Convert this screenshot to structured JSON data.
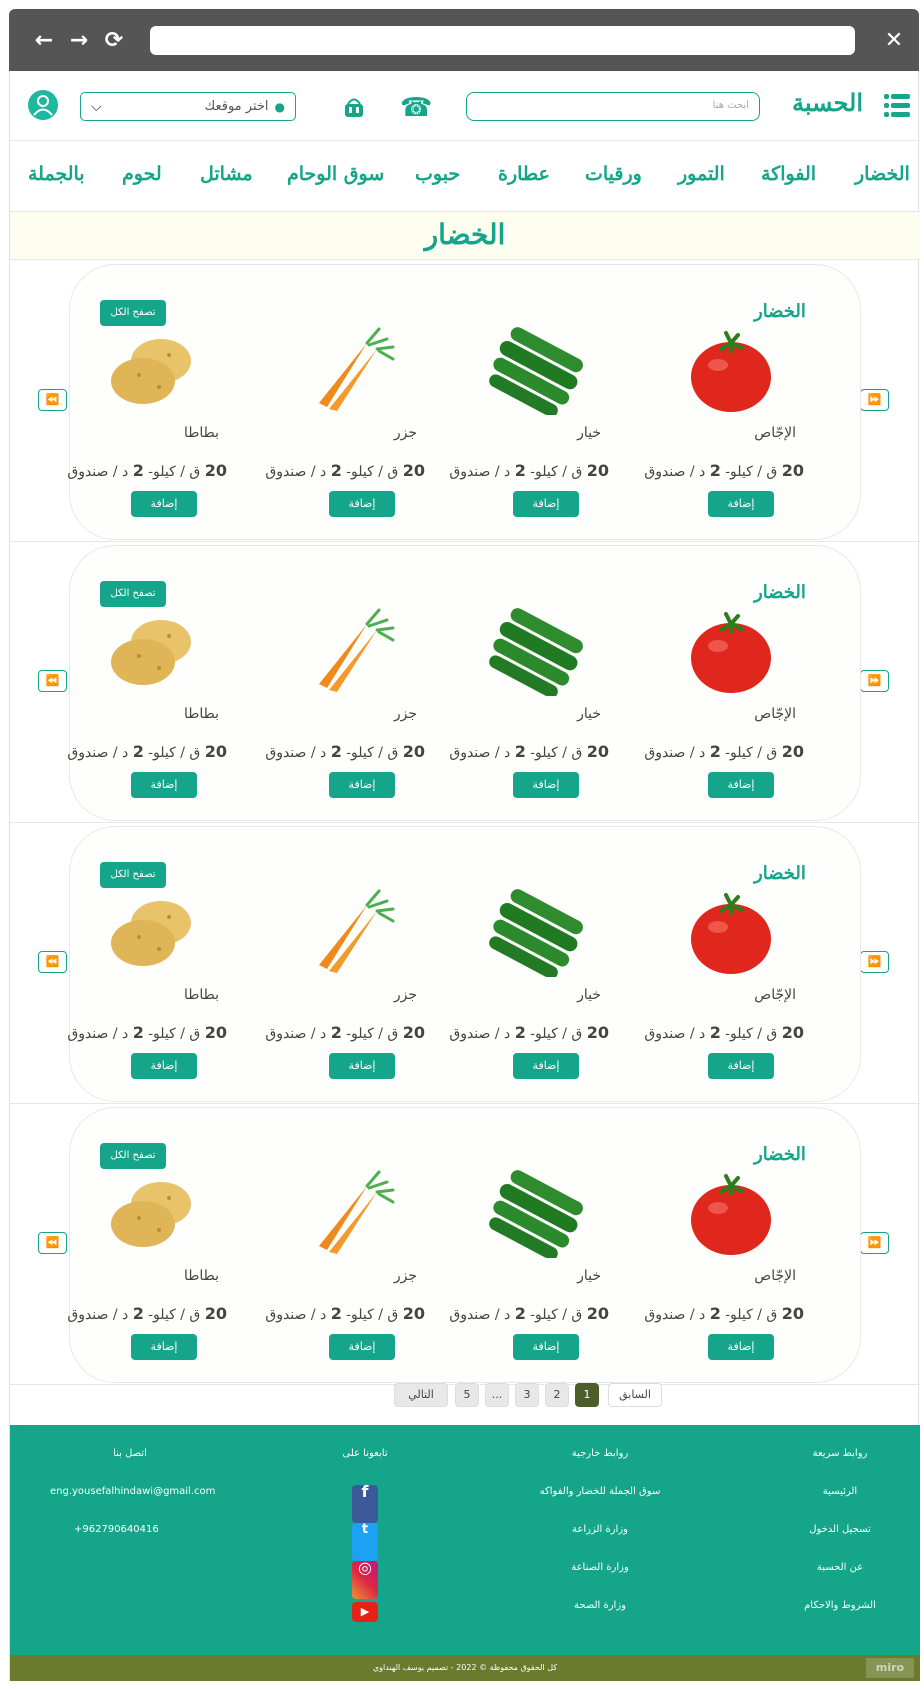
{
  "browser": {
    "back": "←",
    "forward": "→",
    "reload": "⟳",
    "close": "✕"
  },
  "header": {
    "brand": "الحسبة",
    "search_placeholder": "ابحث هنا",
    "location_label": "اختر موقعك",
    "phone_icon": "☎"
  },
  "categories": [
    "الخضار",
    "الفواكة",
    "التمور",
    "ورقيات",
    "عطارة",
    "حبوب",
    "سوق الوحام",
    "مشاتل",
    "لحوم",
    "بالجملة"
  ],
  "section_title": "الخضار",
  "rows": [
    {
      "title": "الخضار",
      "browse_all": "تصفح الكل"
    },
    {
      "title": "الخضار",
      "browse_all": "تصفح الكل"
    },
    {
      "title": "الخضار",
      "browse_all": "تصفح الكل"
    },
    {
      "title": "الخضار",
      "browse_all": "تصفح الكل"
    }
  ],
  "products": [
    {
      "name": "الإجّاص",
      "price_qirsh": "20",
      "price_mid": "ق / كيلو- ",
      "price_dinar": "2",
      "price_end": "د / صندوق",
      "add": "إضافة",
      "icon": "tomato"
    },
    {
      "name": "خيار",
      "price_qirsh": "20",
      "price_mid": "ق / كيلو- ",
      "price_dinar": "2",
      "price_end": "د / صندوق",
      "add": "إضافة",
      "icon": "cucumber"
    },
    {
      "name": "جزر",
      "price_qirsh": "20",
      "price_mid": "ق / كيلو- ",
      "price_dinar": "2",
      "price_end": "د / صندوق",
      "add": "إضافة",
      "icon": "carrot"
    },
    {
      "name": "بطاطا",
      "price_qirsh": "20",
      "price_mid": "ق / كيلو- ",
      "price_dinar": "2",
      "price_end": "د / صندوق",
      "add": "إضافة",
      "icon": "potato"
    }
  ],
  "pagination": {
    "prev": "السابق",
    "next": "التالي",
    "pages": [
      "1",
      "2",
      "3",
      "...",
      "5"
    ],
    "active": "1"
  },
  "footer": {
    "quick_links": {
      "title": "روابط سريعة",
      "items": [
        "الرئيسية",
        "تسجيل الدخول",
        "عن الحسبة",
        "الشروط والاحكام"
      ]
    },
    "external_links": {
      "title": "روابط خارجية",
      "items": [
        "سوق الجملة للخضار والفواكه",
        "وزارة الزراعة",
        "وزارة الصناعة",
        "وزارة الصحة"
      ]
    },
    "follow": {
      "title": "تابعونا على",
      "items": [
        "facebook-icon",
        "twitter-icon",
        "instagram-icon",
        "youtube-icon"
      ]
    },
    "contact": {
      "title": "اتصل بنا",
      "email": "eng.yousefalhindawi@gmail.com",
      "phone": "+962790640416"
    },
    "copyright": "كل الحقوق محفوظة © 2022 - تصميم يوسف الهنداوي",
    "watermark": "miro"
  },
  "colors": {
    "accent": "#14a58a",
    "footer_bottom": "#6b7a2c",
    "title_bg": "#fdfdf0"
  }
}
